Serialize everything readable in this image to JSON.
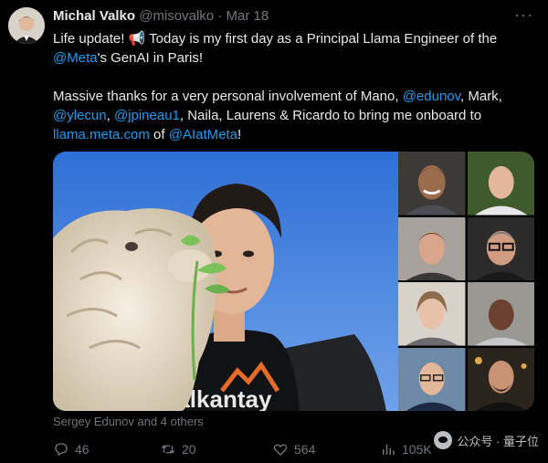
{
  "author": {
    "name": "Michal Valko",
    "handle": "@misovalko",
    "separator": "·",
    "date": "Mar 18"
  },
  "more_label": "···",
  "tweet": {
    "p1_a": "Life update! ",
    "p1_emoji": "📢",
    "p1_b": " Today is my first day as a Principal Llama Engineer of the ",
    "p1_link_meta": "@Meta",
    "p1_c": "'s GenAI in Paris!",
    "p2_a": "Massive thanks for a very personal involvement of Mano, ",
    "p2_link_edunov": "@edunov",
    "p2_b": ", Mark, ",
    "p2_link_ylecun": "@ylecun",
    "p2_c": ", ",
    "p2_link_jpineau": "@jpineau1",
    "p2_d": ", Naila, Laurens & Ricardo to bring me onboard to ",
    "p2_link_site": "llama.meta.com",
    "p2_e": " of ",
    "p2_link_aiatmeta": "@AIatMeta",
    "p2_f": "!"
  },
  "media": {
    "shirt_text": "Salkantay"
  },
  "tagged": "Sergey Edunov and 4 others",
  "actions": {
    "replies": "46",
    "retweets": "20",
    "likes": "564",
    "views": "105K"
  },
  "watermark": "公众号 · 量子位",
  "colors": {
    "link": "#1d9bf0",
    "muted": "#71767b",
    "text": "#e7e9ea",
    "background": "#000000"
  }
}
